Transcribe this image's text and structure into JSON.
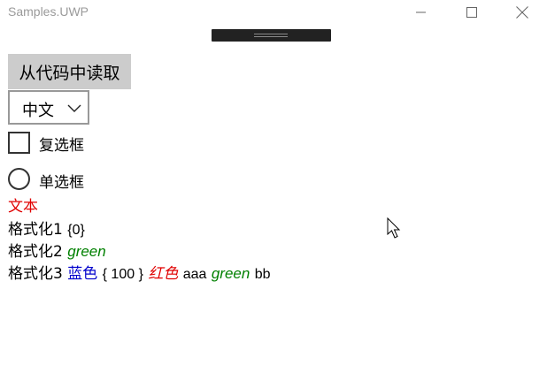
{
  "window": {
    "title": "Samples.UWP"
  },
  "toolbar": {
    "read_button_label": "从代码中读取"
  },
  "combo": {
    "selected": "中文"
  },
  "checkbox": {
    "label": "复选框",
    "checked": false
  },
  "radio": {
    "label": "单选框",
    "selected": false
  },
  "lines": {
    "wenben": {
      "text": "文本",
      "color": "#e00000"
    },
    "format1": {
      "prefix": "格式化1",
      "value": "{0}"
    },
    "format2": {
      "prefix": "格式化2",
      "green": "green",
      "green_color": "#008000"
    },
    "format3": {
      "prefix": "格式化3",
      "blue_text": "蓝色",
      "blue_color": "#0000cc",
      "braced": "{ 100 }",
      "red_text": "红色",
      "red_color": "#e00000",
      "aaa": "aaa",
      "green": "green",
      "green_color": "#008000",
      "bb": "bb"
    }
  },
  "icons": {
    "minimize": "minimize-icon",
    "maximize": "maximize-icon",
    "close": "close-icon",
    "chevron": "chevron-down-icon",
    "cursor": "mouse-pointer-icon"
  }
}
